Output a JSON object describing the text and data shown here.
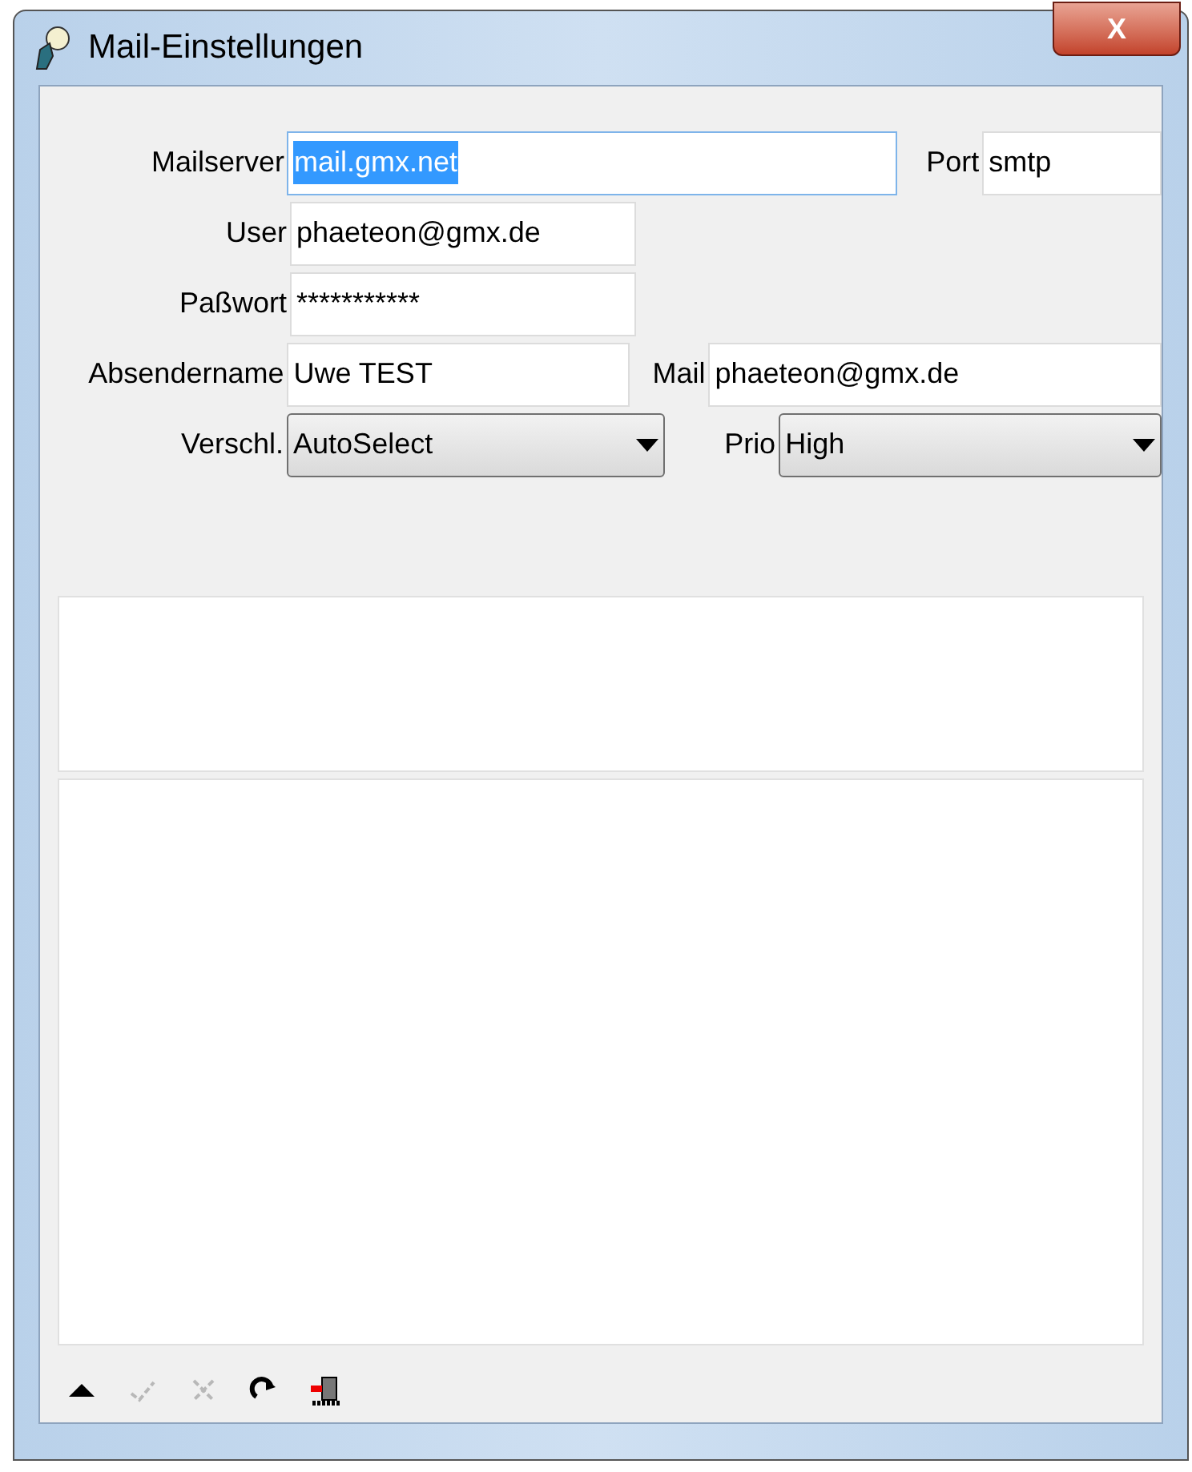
{
  "window": {
    "title": "Mail-Einstellungen",
    "close_label": "X"
  },
  "fields": [
    {
      "label": "Mailserver",
      "value": "mail.gmx.net",
      "focused": true,
      "extra": {
        "label": "Port",
        "value": "smtp"
      }
    },
    {
      "label": "User",
      "value": "phaeteon@gmx.de",
      "focused": false
    },
    {
      "label": "Paßwort",
      "value": "***********",
      "focused": false
    },
    {
      "label": "Absendername",
      "value": "Uwe TEST",
      "focused": false,
      "extra": {
        "label": "Mail",
        "value": "phaeteon@gmx.de"
      }
    }
  ],
  "selects": {
    "encryption": {
      "label": "Verschl.",
      "value": "AutoSelect"
    },
    "priority": {
      "label": "Prio",
      "value": "High"
    }
  },
  "toolbar": [
    {
      "kind": "up",
      "disabled": false
    },
    {
      "kind": "check",
      "disabled": true
    },
    {
      "kind": "cross",
      "disabled": true
    },
    {
      "kind": "refresh",
      "disabled": false
    },
    {
      "kind": "exit",
      "disabled": false
    }
  ]
}
